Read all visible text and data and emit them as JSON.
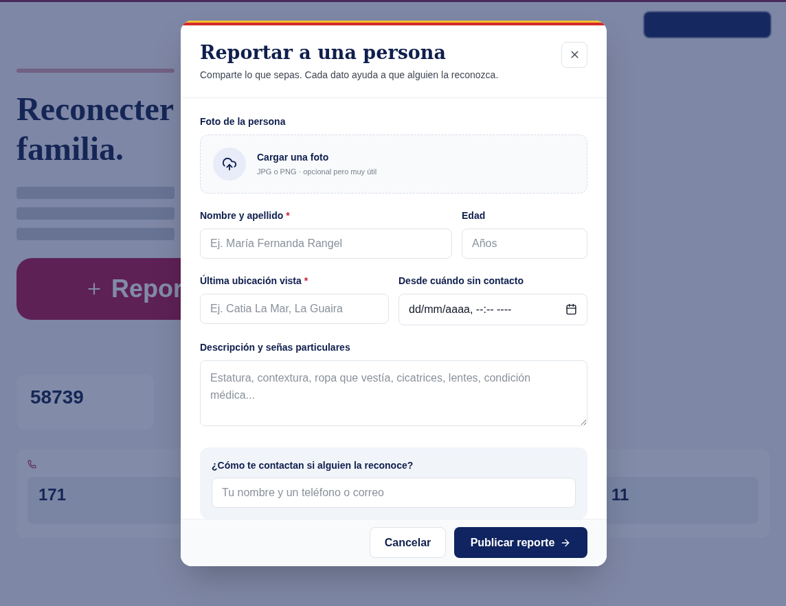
{
  "background": {
    "headline_lines": [
      "Reconecter",
      "familia."
    ],
    "report_button": "Repor",
    "stats": [
      "58739"
    ],
    "phones": [
      "171",
      "11"
    ]
  },
  "modal": {
    "title": "Reportar a una persona",
    "subtitle": "Comparte lo que sepas. Cada dato ayuda a que alguien la reconozca.",
    "photo": {
      "label": "Foto de la persona",
      "action": "Cargar una foto",
      "hint": "JPG o PNG · opcional pero muy útil"
    },
    "required_mark": "*",
    "rows": [
      [
        {
          "kind": "text",
          "label": "Nombre y apellido",
          "required": true,
          "placeholder": "Ej. María Fernanda Rangel"
        },
        {
          "kind": "text",
          "label": "Edad",
          "required": false,
          "placeholder": "Años"
        }
      ],
      [
        {
          "kind": "text",
          "label": "Última ubicación vista",
          "required": true,
          "placeholder": "Ej. Catia La Mar, La Guaira"
        },
        {
          "kind": "date",
          "label": "Desde cuándo sin contacto",
          "required": false,
          "value": "dd/mm/aaaa, --:-- ----"
        }
      ],
      [
        {
          "kind": "textarea",
          "label": "Descripción y señas particulares",
          "required": false,
          "placeholder": "Estatura, contextura, ropa que vestía, cicatrices, lentes, condición médica..."
        }
      ]
    ],
    "contact": {
      "label": "¿Cómo te contactan si alguien la reconoce?",
      "placeholder": "Tu nombre y un teléfono o correo"
    },
    "buttons": {
      "cancel": "Cancelar",
      "submit": "Publicar reporte"
    }
  }
}
